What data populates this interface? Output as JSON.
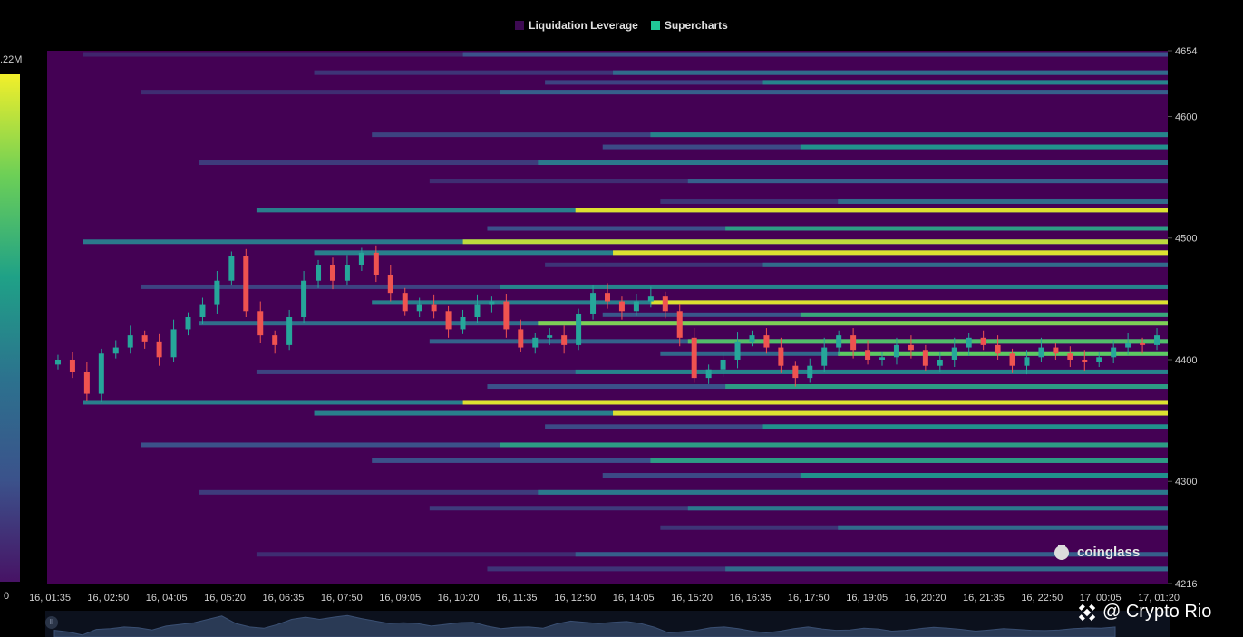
{
  "legend": {
    "items": [
      {
        "label": "Liquidation Leverage",
        "color": "#3d0a52"
      },
      {
        "label": "Supercharts",
        "color": "#20c997"
      }
    ]
  },
  "colorbar": {
    "max_label": ".22M",
    "min_label": "0",
    "colors": [
      "#f2ef2a",
      "#6ccf57",
      "#1fa187",
      "#2c728e",
      "#3b528b",
      "#471365"
    ]
  },
  "watermark": {
    "text": "coinglass"
  },
  "credit": {
    "text": "@ Crypto Rio"
  },
  "chart_data": {
    "type": "heatmap",
    "x_tick_labels": [
      "16, 01:35",
      "16, 02:50",
      "16, 04:05",
      "16, 05:20",
      "16, 06:35",
      "16, 07:50",
      "16, 09:05",
      "16, 10:20",
      "16, 11:35",
      "16, 12:50",
      "16, 14:05",
      "16, 15:20",
      "16, 16:35",
      "16, 17:50",
      "16, 19:05",
      "16, 20:20",
      "16, 21:35",
      "16, 22:50",
      "17, 00:05",
      "17, 01:20"
    ],
    "y_tick_labels": [
      "4654",
      "4600",
      "4500",
      "4400",
      "4300",
      "4216"
    ],
    "ylim": [
      4216,
      4654
    ],
    "background_color": "#440154",
    "price_candles_approx_close": [
      4400,
      4390,
      4372,
      4405,
      4410,
      4420,
      4415,
      4402,
      4425,
      4435,
      4445,
      4465,
      4485,
      4440,
      4420,
      4412,
      4435,
      4465,
      4478,
      4465,
      4478,
      4488,
      4470,
      4455,
      4440,
      4445,
      4440,
      4425,
      4435,
      4445,
      4448,
      4425,
      4410,
      4418,
      4420,
      4412,
      4438,
      4455,
      4448,
      4440,
      4448,
      4452,
      4440,
      4418,
      4385,
      4392,
      4400,
      4415,
      4420,
      4410,
      4395,
      4385,
      4395,
      4410,
      4420,
      4408,
      4400,
      4402,
      4412,
      4408,
      4395,
      4400,
      4410,
      4418,
      4412,
      4405,
      4395,
      4402,
      4410,
      4405,
      4400,
      4398,
      4402,
      4410,
      4414,
      4412,
      4420
    ],
    "liquidation_bands": [
      {
        "price": 4651,
        "level": 0.25
      },
      {
        "price": 4636,
        "level": 0.35
      },
      {
        "price": 4628,
        "level": 0.45
      },
      {
        "price": 4620,
        "level": 0.3
      },
      {
        "price": 4585,
        "level": 0.45
      },
      {
        "price": 4575,
        "level": 0.5
      },
      {
        "price": 4562,
        "level": 0.4
      },
      {
        "price": 4547,
        "level": 0.3
      },
      {
        "price": 4530,
        "level": 0.35
      },
      {
        "price": 4523,
        "level": 0.95
      },
      {
        "price": 4508,
        "level": 0.55
      },
      {
        "price": 4497,
        "level": 0.9
      },
      {
        "price": 4488,
        "level": 0.95
      },
      {
        "price": 4478,
        "level": 0.35
      },
      {
        "price": 4460,
        "level": 0.45
      },
      {
        "price": 4447,
        "level": 0.95
      },
      {
        "price": 4437,
        "level": 0.6
      },
      {
        "price": 4430,
        "level": 0.8
      },
      {
        "price": 4415,
        "level": 0.7
      },
      {
        "price": 4405,
        "level": 0.75
      },
      {
        "price": 4390,
        "level": 0.45
      },
      {
        "price": 4378,
        "level": 0.55
      },
      {
        "price": 4365,
        "level": 0.95
      },
      {
        "price": 4356,
        "level": 0.95
      },
      {
        "price": 4345,
        "level": 0.5
      },
      {
        "price": 4330,
        "level": 0.55
      },
      {
        "price": 4317,
        "level": 0.55
      },
      {
        "price": 4305,
        "level": 0.5
      },
      {
        "price": 4291,
        "level": 0.4
      },
      {
        "price": 4278,
        "level": 0.4
      },
      {
        "price": 4262,
        "level": 0.35
      },
      {
        "price": 4240,
        "level": 0.3
      },
      {
        "price": 4228,
        "level": 0.35
      }
    ]
  }
}
